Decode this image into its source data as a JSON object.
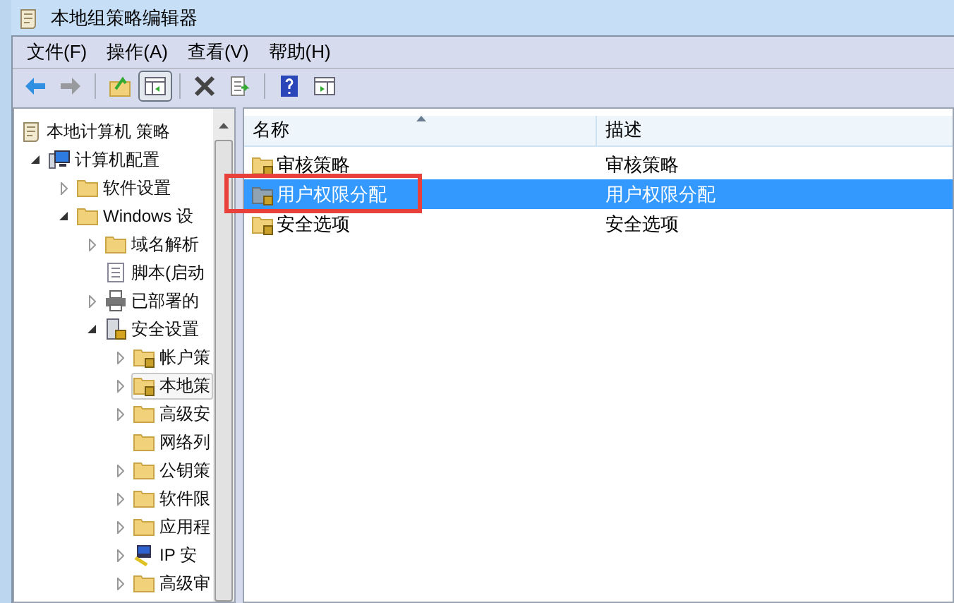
{
  "window": {
    "title": "本地组策略编辑器"
  },
  "menu": [
    "文件(F)",
    "操作(A)",
    "查看(V)",
    "帮助(H)"
  ],
  "toolbar": [
    {
      "kind": "back",
      "disabled": false
    },
    {
      "kind": "forward",
      "disabled": true
    },
    {
      "kind": "sep"
    },
    {
      "kind": "up",
      "disabled": false
    },
    {
      "kind": "tree",
      "disabled": false,
      "pressed": true
    },
    {
      "kind": "sep"
    },
    {
      "kind": "delete",
      "disabled": false
    },
    {
      "kind": "export",
      "disabled": false
    },
    {
      "kind": "sep"
    },
    {
      "kind": "help",
      "disabled": false
    },
    {
      "kind": "pane",
      "disabled": false,
      "pressed": false
    }
  ],
  "tree": [
    {
      "label": "本地计算机 策略",
      "kind": "scroll",
      "expandable": false,
      "expanded": false,
      "selected": false,
      "children": [
        {
          "label": "计算机配置",
          "kind": "computer",
          "expandable": true,
          "expanded": true,
          "selected": false,
          "children": [
            {
              "label": "软件设置",
              "kind": "folder",
              "expandable": true,
              "expanded": false,
              "selected": false
            },
            {
              "label": "Windows 设",
              "kind": "folder",
              "expandable": true,
              "expanded": true,
              "selected": false,
              "children": [
                {
                  "label": "域名解析",
                  "kind": "folder",
                  "expandable": true,
                  "expanded": false,
                  "selected": false
                },
                {
                  "label": "脚本(启动",
                  "kind": "script",
                  "expandable": false,
                  "expanded": false,
                  "selected": false
                },
                {
                  "label": "已部署的",
                  "kind": "printer",
                  "expandable": true,
                  "expanded": false,
                  "selected": false
                },
                {
                  "label": "安全设置",
                  "kind": "security",
                  "expandable": true,
                  "expanded": true,
                  "selected": false,
                  "children": [
                    {
                      "label": "帐户策",
                      "kind": "folder-lock",
                      "expandable": true,
                      "expanded": false,
                      "selected": false
                    },
                    {
                      "label": "本地策",
                      "kind": "folder-lock",
                      "expandable": true,
                      "expanded": false,
                      "selected": true
                    },
                    {
                      "label": "高级安",
                      "kind": "folder",
                      "expandable": true,
                      "expanded": false,
                      "selected": false
                    },
                    {
                      "label": "网络列",
                      "kind": "folder",
                      "expandable": false,
                      "expanded": false,
                      "selected": false
                    },
                    {
                      "label": "公钥策",
                      "kind": "folder",
                      "expandable": true,
                      "expanded": false,
                      "selected": false
                    },
                    {
                      "label": "软件限",
                      "kind": "folder",
                      "expandable": true,
                      "expanded": false,
                      "selected": false
                    },
                    {
                      "label": "应用程",
                      "kind": "folder",
                      "expandable": true,
                      "expanded": false,
                      "selected": false
                    },
                    {
                      "label": "IP 安",
                      "kind": "ip",
                      "expandable": true,
                      "expanded": false,
                      "selected": false
                    },
                    {
                      "label": "高级审",
                      "kind": "folder",
                      "expandable": true,
                      "expanded": false,
                      "selected": false
                    }
                  ]
                }
              ]
            }
          ]
        }
      ]
    }
  ],
  "table": {
    "columns": [
      {
        "label": "名称",
        "sorted": true
      },
      {
        "label": "描述",
        "sorted": false
      }
    ],
    "rows": [
      {
        "name": "审核策略",
        "description": "审核策略",
        "selected": false,
        "annotated": false
      },
      {
        "name": "用户权限分配",
        "description": "用户权限分配",
        "selected": true,
        "annotated": true
      },
      {
        "name": "安全选项",
        "description": "安全选项",
        "selected": false,
        "annotated": false
      }
    ]
  }
}
